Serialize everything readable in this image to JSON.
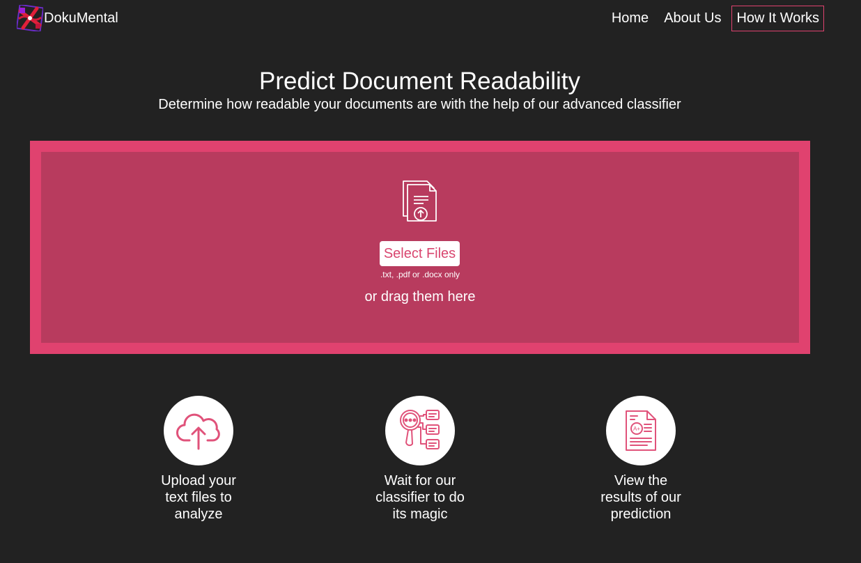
{
  "brand": {
    "name": "DokuMental"
  },
  "nav": {
    "items": [
      {
        "label": "Home",
        "active": false
      },
      {
        "label": "About Us",
        "active": false
      },
      {
        "label": "How It Works",
        "active": true
      }
    ]
  },
  "hero": {
    "title": "Predict Document Readability",
    "subtitle": "Determine how readable your documents are with the help of our advanced classifier"
  },
  "dropzone": {
    "icon": "document-upload-icon",
    "button_label": "Select Files",
    "file_types": ".txt, .pdf or .docx only",
    "drag_text": "or drag them here"
  },
  "steps": [
    {
      "icon": "cloud-upload-icon",
      "text": "Upload your text files to analyze"
    },
    {
      "icon": "magnifier-analysis-icon",
      "text": "Wait for our classifier to do its magic"
    },
    {
      "icon": "graded-document-icon",
      "text": "View the results of our prediction"
    }
  ],
  "colors": {
    "background": "#222222",
    "accent": "#e0426f",
    "dropzone_inner": "#b83b5e",
    "icon_pink": "#e0527a",
    "text": "#ffffff"
  }
}
